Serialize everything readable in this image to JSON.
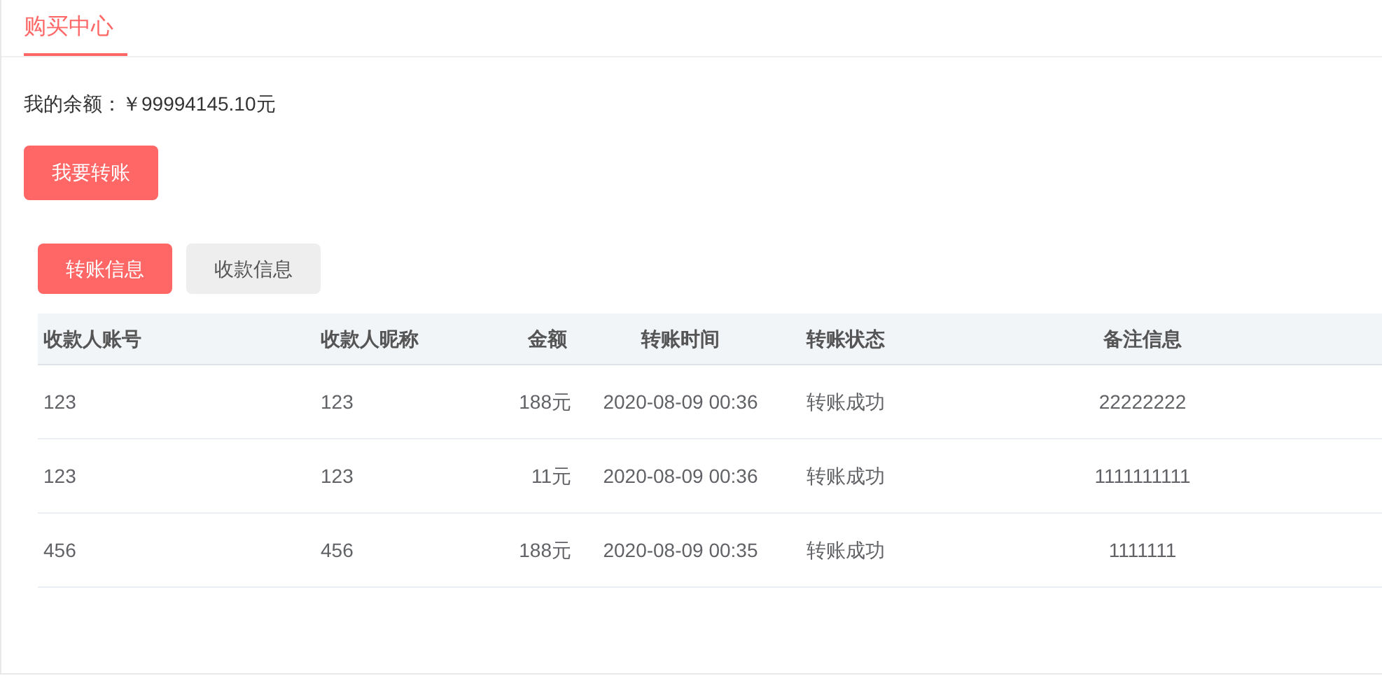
{
  "page_tab": {
    "label": "购买中心",
    "selected": true
  },
  "balance": {
    "label": "我的余额：",
    "value": "￥99994145.10元"
  },
  "transfer_button": "我要转账",
  "tabs": [
    {
      "label": "转账信息",
      "selected": true
    },
    {
      "label": "收款信息",
      "selected": false
    }
  ],
  "table": {
    "columns": [
      "收款人账号",
      "收款人昵称",
      "金额",
      "转账时间",
      "转账状态",
      "备注信息"
    ],
    "rows": [
      [
        "123",
        "123",
        "188元",
        "2020-08-09 00:36",
        "转账成功",
        "22222222"
      ],
      [
        "123",
        "123",
        "11元",
        "2020-08-09 00:36",
        "转账成功",
        "1111111111"
      ],
      [
        "456",
        "456",
        "188元",
        "2020-08-09 00:35",
        "转账成功",
        "1111111"
      ]
    ]
  }
}
